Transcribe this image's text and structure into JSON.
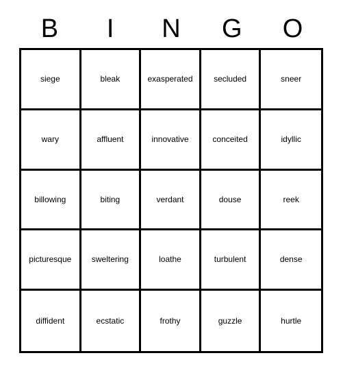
{
  "card": {
    "title": "BINGO",
    "header_letters": [
      "B",
      "I",
      "N",
      "G",
      "O"
    ],
    "grid_size": "5x5",
    "border_color": "#000000",
    "background_color": "#ffffff",
    "text_color": "#000000",
    "rows": [
      {
        "cells": [
          {
            "word": "siege"
          },
          {
            "word": "bleak"
          },
          {
            "word": "exasperated"
          },
          {
            "word": "secluded"
          },
          {
            "word": "sneer"
          }
        ]
      },
      {
        "cells": [
          {
            "word": "wary"
          },
          {
            "word": "affluent"
          },
          {
            "word": "innovative"
          },
          {
            "word": "conceited"
          },
          {
            "word": "idyllic"
          }
        ]
      },
      {
        "cells": [
          {
            "word": "billowing"
          },
          {
            "word": "biting"
          },
          {
            "word": "verdant"
          },
          {
            "word": "douse"
          },
          {
            "word": "reek"
          }
        ]
      },
      {
        "cells": [
          {
            "word": "picturesque"
          },
          {
            "word": "sweltering"
          },
          {
            "word": "loathe"
          },
          {
            "word": "turbulent"
          },
          {
            "word": "dense"
          }
        ]
      },
      {
        "cells": [
          {
            "word": "diffident"
          },
          {
            "word": "ecstatic"
          },
          {
            "word": "frothy"
          },
          {
            "word": "guzzle"
          },
          {
            "word": "hurtle"
          }
        ]
      }
    ]
  }
}
